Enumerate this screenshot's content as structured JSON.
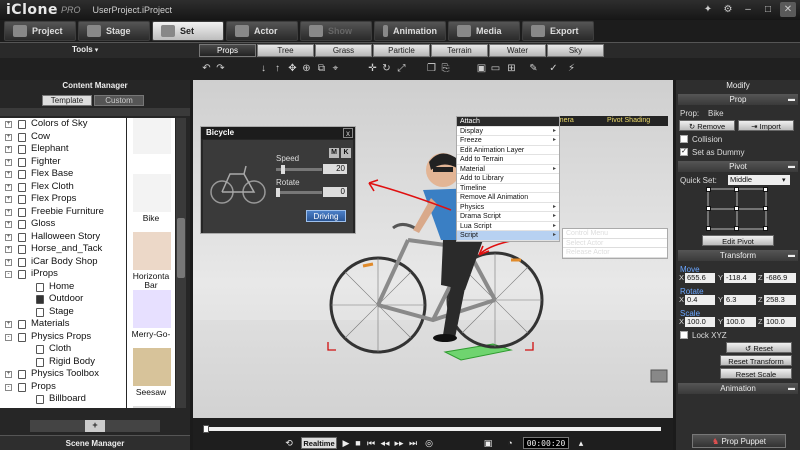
{
  "app": {
    "logo": "iClone",
    "logo_suffix": "PRO",
    "project_title": "UserProject.iProject",
    "window_controls": [
      "tools-icon",
      "gear-icon",
      "minimize-icon",
      "maximize-icon",
      "close-icon"
    ]
  },
  "main_tabs": [
    {
      "label": "Project",
      "icon": "folder-icon"
    },
    {
      "label": "Stage",
      "icon": "stage-icon"
    },
    {
      "label": "Set",
      "icon": "set-icon",
      "active": true
    },
    {
      "label": "Actor",
      "icon": "actor-icon"
    },
    {
      "label": "Show",
      "icon": "show-icon",
      "disabled": true
    },
    {
      "label": "Animation",
      "icon": "animation-icon"
    },
    {
      "label": "Media",
      "icon": "media-icon"
    },
    {
      "label": "Export",
      "icon": "export-icon"
    }
  ],
  "sub_tabs": {
    "tools_label": "Tools",
    "items": [
      "Props",
      "Tree",
      "Grass",
      "Particle",
      "Terrain",
      "Water",
      "Sky"
    ],
    "active": "Props"
  },
  "content_manager": {
    "title": "Content Manager",
    "tabs": [
      "Template",
      "Custom"
    ],
    "active_tab": "Template",
    "tree_items": [
      {
        "label": "Colors of Sky",
        "level": 0,
        "expander": "+"
      },
      {
        "label": "Cow",
        "level": 0,
        "expander": "+"
      },
      {
        "label": "Elephant",
        "level": 0,
        "expander": "+"
      },
      {
        "label": "Fighter",
        "level": 0,
        "expander": "+"
      },
      {
        "label": "Flex Base",
        "level": 0,
        "expander": "+"
      },
      {
        "label": "Flex Cloth",
        "level": 0,
        "expander": "+"
      },
      {
        "label": "Flex Props",
        "level": 0,
        "expander": "+"
      },
      {
        "label": "Freebie Furniture",
        "level": 0,
        "expander": "+"
      },
      {
        "label": "Gloss",
        "level": 0,
        "expander": "+"
      },
      {
        "label": "Halloween Story",
        "level": 0,
        "expander": "+"
      },
      {
        "label": "Horse_and_Tack",
        "level": 0,
        "expander": "+"
      },
      {
        "label": "iCar Body Shop",
        "level": 0,
        "expander": "+"
      },
      {
        "label": "iProps",
        "level": 0,
        "expander": "-"
      },
      {
        "label": "Home",
        "level": 1,
        "expander": ""
      },
      {
        "label": "Outdoor",
        "level": 1,
        "expander": "",
        "selected": true
      },
      {
        "label": "Stage",
        "level": 1,
        "expander": ""
      },
      {
        "label": "Materials",
        "level": 0,
        "expander": "+"
      },
      {
        "label": "Physics Props",
        "level": 0,
        "expander": "-"
      },
      {
        "label": "Cloth",
        "level": 1,
        "expander": ""
      },
      {
        "label": "Rigid Body",
        "level": 1,
        "expander": ""
      },
      {
        "label": "Physics Toolbox",
        "level": 0,
        "expander": "+"
      },
      {
        "label": "Props",
        "level": 0,
        "expander": "-"
      },
      {
        "label": "Billboard",
        "level": 1,
        "expander": ""
      }
    ],
    "thumbnails": [
      {
        "label": "",
        "icon": "bicycle-thumb-icon"
      },
      {
        "label": "Bike",
        "icon": "bike-thumb-icon"
      },
      {
        "label": "Horizonta Bar",
        "icon": "horizontal-bar-thumb-icon"
      },
      {
        "label": "Merry-Go-",
        "icon": "merry-go-round-thumb-icon"
      },
      {
        "label": "Seesaw",
        "icon": "seesaw-thumb-icon"
      },
      {
        "label": "",
        "icon": "swing-thumb-icon"
      }
    ],
    "add_button": "+"
  },
  "scene_manager": {
    "title": "Scene Manager"
  },
  "bicycle_dialog": {
    "title": "Bicycle",
    "close": "x",
    "speed_label": "Speed",
    "speed_value": "20",
    "speed_fraction": 0.12,
    "rotate_label": "Rotate",
    "rotate_value": "0",
    "rotate_fraction": 0.0,
    "m_label": "M",
    "k_label": "K",
    "driving_button": "Driving"
  },
  "context_menu": {
    "header_left": "Attach",
    "header_mid": "Preview Camera",
    "header_right": "Pivot Shading",
    "items": [
      {
        "label": "Display",
        "submenu": true
      },
      {
        "label": "Freeze",
        "submenu": true
      },
      {
        "label": "Edit Animation Layer"
      },
      {
        "label": "Add to Terrain"
      },
      {
        "label": "Material",
        "submenu": true
      },
      {
        "label": "Add to Library"
      },
      {
        "label": "Timeline"
      },
      {
        "label": "Remove All Animation"
      },
      {
        "label": "Physics",
        "submenu": true
      },
      {
        "label": "Drama Script",
        "submenu": true
      },
      {
        "label": "Lua Script",
        "submenu": true
      },
      {
        "label": "Script",
        "submenu": true,
        "selected": true
      }
    ],
    "submenu_items": [
      "Control Menu",
      "Select Actor",
      "Release Actor"
    ]
  },
  "timeline": {
    "realtime_label": "Realtime",
    "timecode": "00:00:20",
    "progress_fraction": 0.0
  },
  "modify_panel": {
    "title": "Modify",
    "prop_section": "Prop",
    "prop_label": "Prop:",
    "prop_value": "Bike",
    "remove_button": "Remove",
    "import_button": "Import",
    "collision_label": "Collision",
    "collision_checked": false,
    "dummy_label": "Set as Dummy",
    "dummy_checked": true,
    "pivot_section": "Pivot",
    "quick_set_label": "Quick Set:",
    "quick_set_value": "Middle",
    "edit_pivot_button": "Edit Pivot",
    "transform_section": "Transform",
    "move_label": "Move",
    "move": {
      "x": "655.6",
      "y": "-118.4",
      "z": "-686.9"
    },
    "rotate_label": "Rotate",
    "rotate": {
      "x": "0.4",
      "y": "6.3",
      "z": "258.3"
    },
    "scale_label": "Scale",
    "scale": {
      "x": "100.0",
      "y": "100.0",
      "z": "100.0"
    },
    "axis_x": "X",
    "axis_y": "Y",
    "axis_z": "Z",
    "lock_xyz_label": "Lock XYZ",
    "reset_button": "Reset",
    "reset_transform_button": "Reset Transform",
    "reset_scale_button": "Reset Scale",
    "animation_section": "Animation",
    "prop_puppet_button": "Prop Puppet"
  },
  "colors": {
    "accent_blue": "#2a5696",
    "annotation_red": "#e01010",
    "menu_highlight": "#b7d1f1"
  }
}
